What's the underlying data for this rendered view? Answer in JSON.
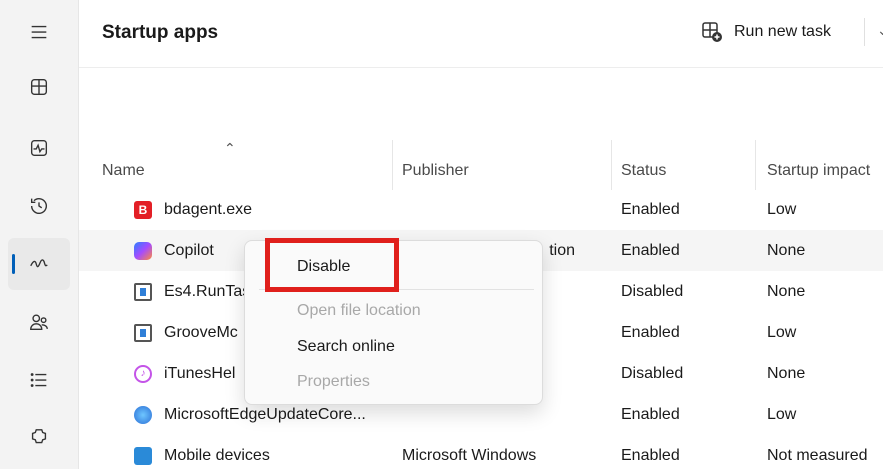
{
  "nav": {
    "items": [
      {
        "icon": "hamburger-menu-icon"
      },
      {
        "icon": "processes-icon"
      },
      {
        "icon": "performance-icon"
      },
      {
        "icon": "app-history-icon"
      },
      {
        "icon": "startup-apps-icon",
        "active": true
      },
      {
        "icon": "users-icon"
      },
      {
        "icon": "details-icon"
      },
      {
        "icon": "services-icon"
      }
    ]
  },
  "header": {
    "title": "Startup apps",
    "run_new_task_label": "Run new task"
  },
  "table": {
    "columns": {
      "name": "Name",
      "publisher": "Publisher",
      "status": "Status",
      "impact": "Startup impact"
    },
    "rows": [
      {
        "name": "bdagent.exe",
        "publisher": "",
        "status": "Enabled",
        "impact": "Low",
        "icon": "bitdefender-icon"
      },
      {
        "name": "Copilot",
        "publisher": "tion",
        "status": "Enabled",
        "impact": "None",
        "icon": "copilot-icon"
      },
      {
        "name": "Es4.RunTas",
        "publisher": "",
        "status": "Disabled",
        "impact": "None",
        "icon": "app-window-icon"
      },
      {
        "name": "GrooveMc",
        "publisher": "",
        "status": "Enabled",
        "impact": "Low",
        "icon": "app-window-icon"
      },
      {
        "name": "iTunesHel",
        "publisher": "",
        "status": "Disabled",
        "impact": "None",
        "icon": "itunes-icon"
      },
      {
        "name": "MicrosoftEdgeUpdateCore...",
        "publisher": "",
        "status": "Enabled",
        "impact": "Low",
        "icon": "edge-update-icon"
      },
      {
        "name": "Mobile devices",
        "publisher": "Microsoft Windows",
        "status": "Enabled",
        "impact": "Not measured",
        "icon": "mobile-devices-icon"
      }
    ]
  },
  "context_menu": {
    "disable": "Disable",
    "open_file_location": "Open file location",
    "search_online": "Search online",
    "properties": "Properties"
  },
  "colors": {
    "accent": "#005fb8",
    "highlight_box": "#e0201c"
  }
}
